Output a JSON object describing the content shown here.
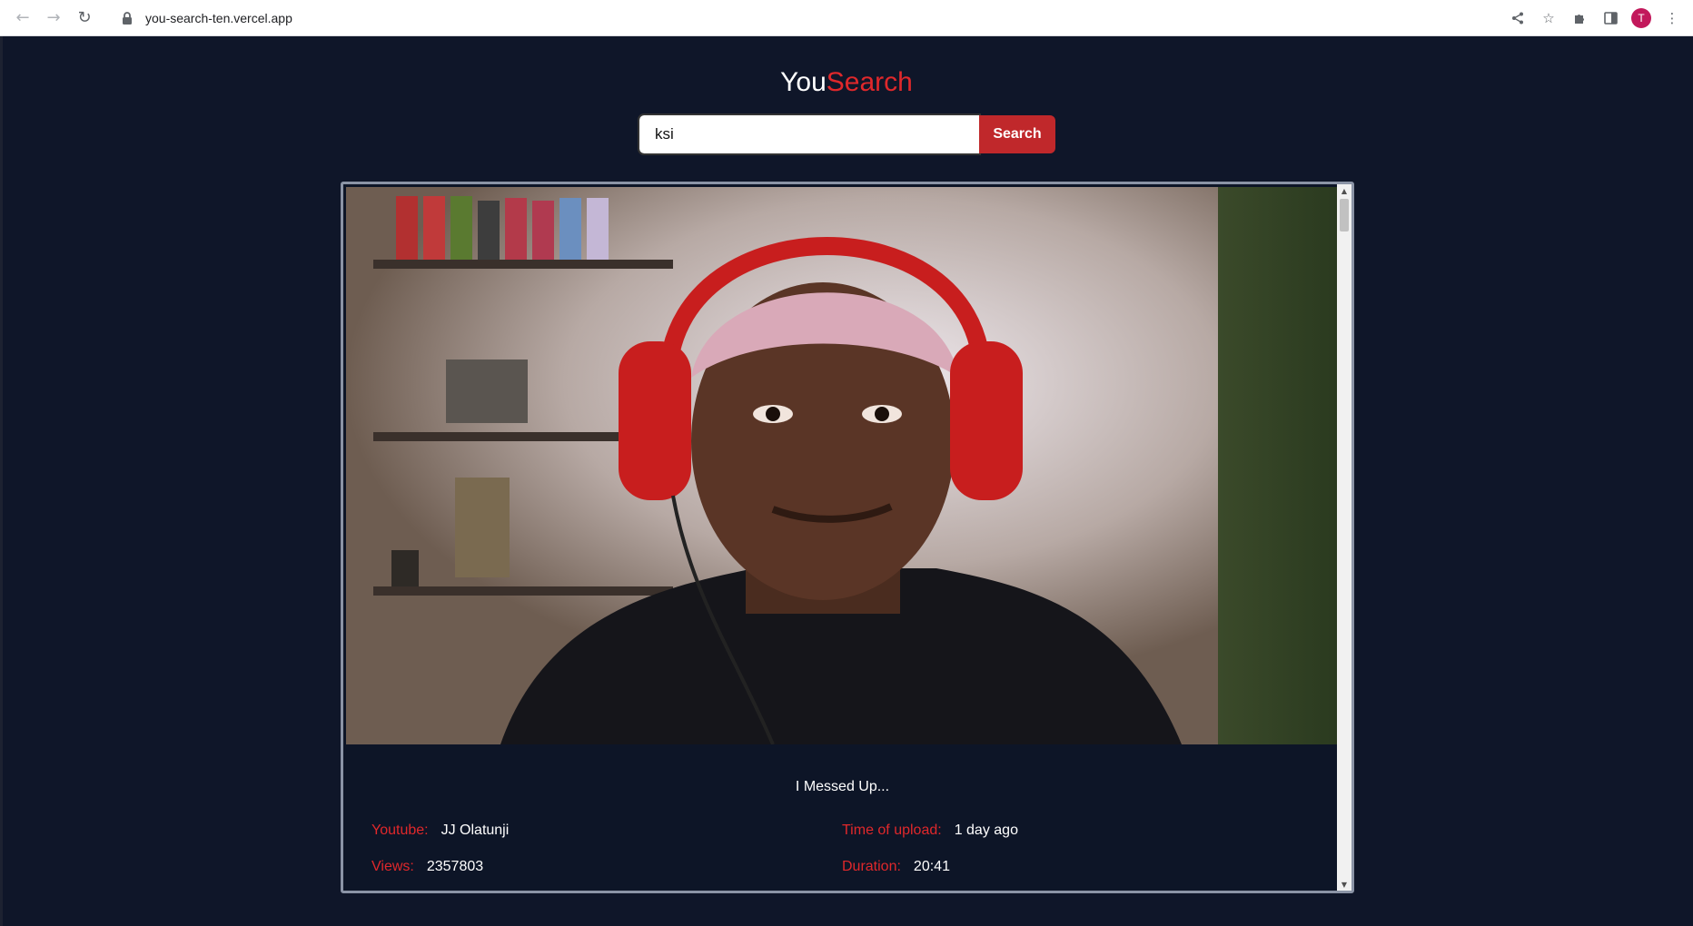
{
  "browser": {
    "url": "you-search-ten.vercel.app",
    "profile_initial": "T",
    "icons": [
      "back-icon",
      "forward-icon",
      "reload-icon",
      "lock-icon",
      "share-icon",
      "star-icon",
      "extensions-icon",
      "side-panel-icon",
      "menu-icon"
    ]
  },
  "app": {
    "logo_part1": "You",
    "logo_part2": "Search",
    "accent_color": "#e0282b",
    "background_color": "#0f1629"
  },
  "search": {
    "value": "ksi",
    "button_label": "Search"
  },
  "result": {
    "title": "I Messed Up...",
    "youtube_label": "Youtube:",
    "channel": "JJ Olatunji",
    "upload_label": "Time of upload:",
    "upload_time": "1 day ago",
    "views_label": "Views:",
    "views": "2357803",
    "duration_label": "Duration:",
    "duration": "20:41"
  }
}
